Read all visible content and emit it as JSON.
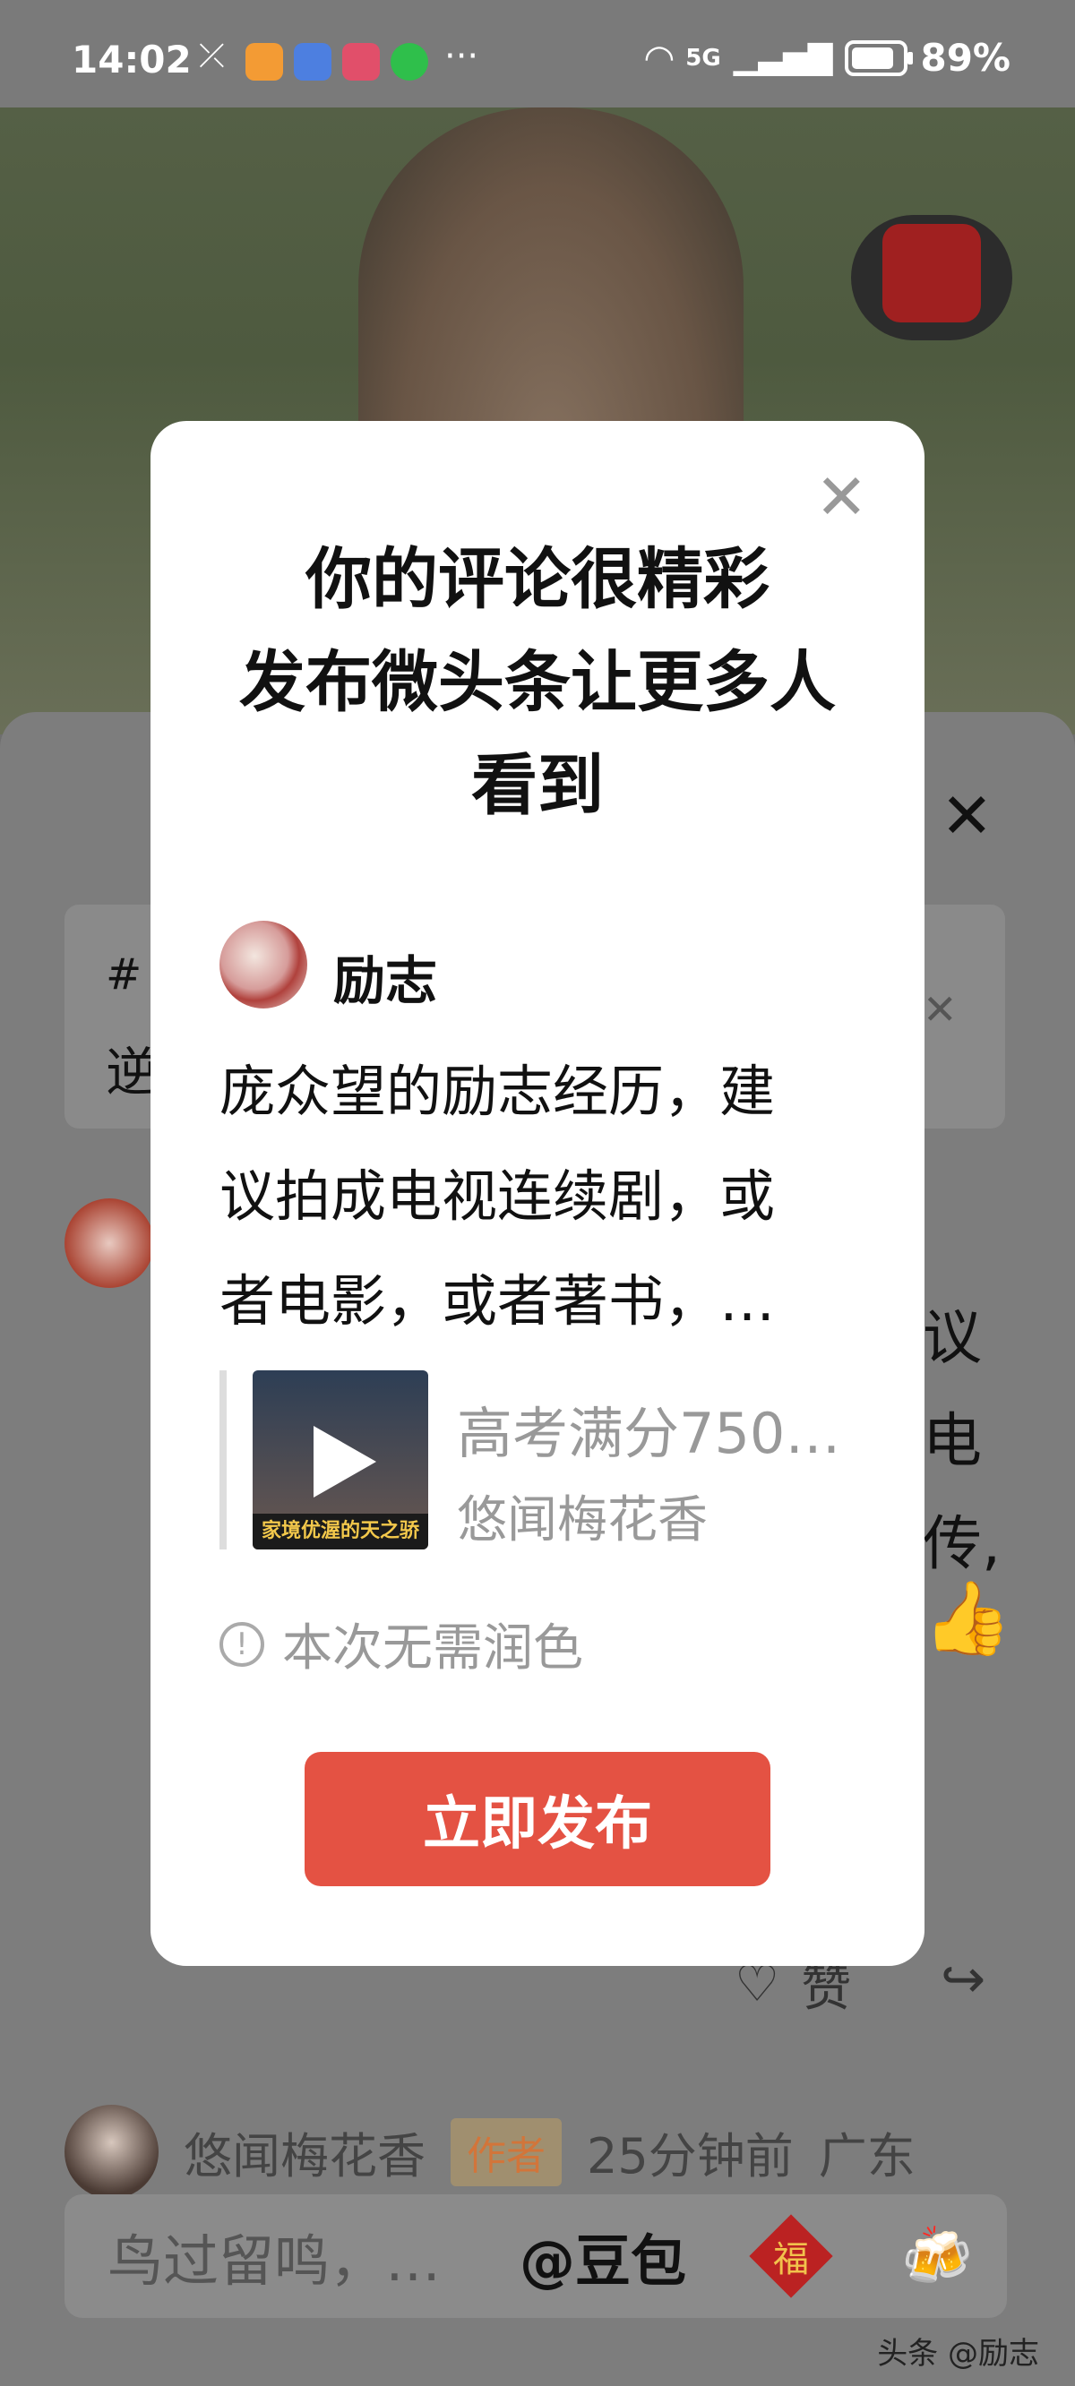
{
  "status_bar": {
    "time": "14:02",
    "network": "5G",
    "battery": "89%",
    "more": "···"
  },
  "background": {
    "sheet_close": "✕",
    "topic_icon": "#",
    "topic_text": "逆",
    "topic_close": "✕",
    "text_line1": "议",
    "text_line2": "电",
    "text_line3": "传,",
    "like_label": "赞",
    "comment": {
      "author": "悠闻梅花香",
      "badge": "作者",
      "time": "25分钟前",
      "location": "广东"
    },
    "input_placeholder": "鸟过留鸣，…",
    "mention": "@豆包",
    "fu_icon": "福",
    "watermark": "头条 @励志"
  },
  "modal": {
    "close": "✕",
    "title_lines": [
      "你的评论很精彩",
      "发布微头条让更多人",
      "看到"
    ],
    "author": "励志",
    "post_lines": [
      "庞众望的励志经历，建",
      "议拍成电视连续剧，或",
      "者电影，或者著书，…"
    ],
    "quote": {
      "title": "高考满分750…",
      "author": "悠闻梅花香",
      "thumb_caption": "家境优渥的天之骄子"
    },
    "info_text": "本次无需润色",
    "info_icon": "!",
    "publish_button": "立即发布"
  }
}
